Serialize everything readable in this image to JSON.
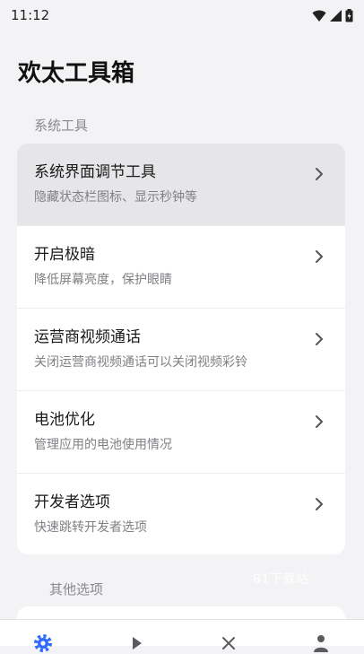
{
  "status_bar": {
    "time": "11:12",
    "icons": [
      "wifi-icon",
      "cellular-signal-icon",
      "battery-charging-icon"
    ]
  },
  "app": {
    "title": "欢太工具箱"
  },
  "sections": {
    "system": {
      "label": "系统工具",
      "items": [
        {
          "title": "系统界面调节工具",
          "subtitle": "隐藏状态栏图标、显示秒钟等",
          "icon": "chevron-right-icon"
        },
        {
          "title": "开启极暗",
          "subtitle": "降低屏幕亮度，保护眼睛",
          "icon": "chevron-right-icon"
        },
        {
          "title": "运营商视频通话",
          "subtitle": "关闭运营商视频通话可以关闭视频彩铃",
          "icon": "chevron-right-icon"
        },
        {
          "title": "电池优化",
          "subtitle": "管理应用的电池使用情况",
          "icon": "chevron-right-icon"
        },
        {
          "title": "开发者选项",
          "subtitle": "快速跳转开发者选项",
          "icon": "chevron-right-icon"
        }
      ]
    },
    "other": {
      "label": "其他选项"
    }
  },
  "watermark": "81下载站",
  "bottom_nav": {
    "items": [
      {
        "icon": "gear-icon",
        "active": true
      },
      {
        "icon": "play-icon",
        "active": false
      },
      {
        "icon": "close-icon",
        "active": false
      },
      {
        "icon": "person-icon",
        "active": false
      }
    ]
  },
  "colors": {
    "accent": "#2f6bff",
    "background": "#f3f3f5",
    "card": "#ffffff"
  }
}
